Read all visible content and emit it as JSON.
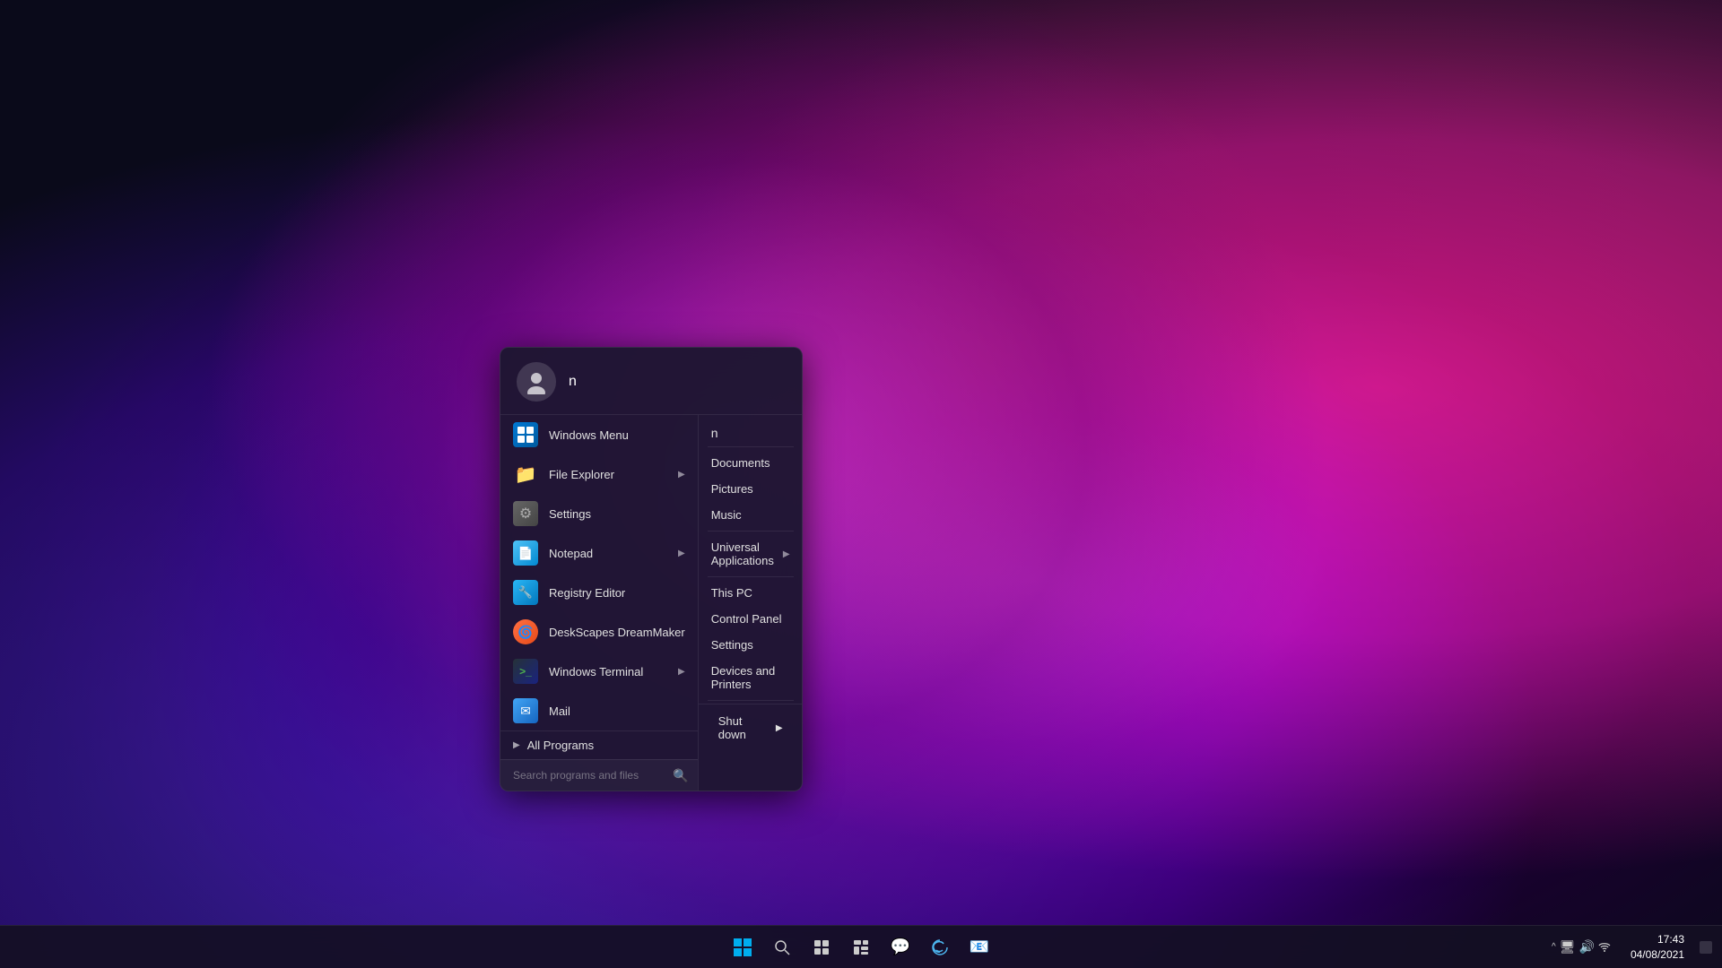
{
  "desktop": {
    "bg_color": "#0a0a1a"
  },
  "start_menu": {
    "user": {
      "name": "n",
      "avatar_icon": "👤"
    },
    "programs": [
      {
        "id": "windows-menu",
        "label": "Windows Menu",
        "icon": "win",
        "has_arrow": false
      },
      {
        "id": "file-explorer",
        "label": "File Explorer",
        "icon": "📁",
        "has_arrow": true
      },
      {
        "id": "settings",
        "label": "Settings",
        "icon": "⚙",
        "has_arrow": false
      },
      {
        "id": "notepad",
        "label": "Notepad",
        "icon": "📝",
        "has_arrow": true
      },
      {
        "id": "registry-editor",
        "label": "Registry Editor",
        "icon": "🔧",
        "has_arrow": false
      },
      {
        "id": "deskscapes",
        "label": "DeskScapes DreamMaker",
        "icon": "🌀",
        "has_arrow": false
      },
      {
        "id": "windows-terminal",
        "label": "Windows Terminal",
        "icon": "▶",
        "has_arrow": true
      },
      {
        "id": "mail",
        "label": "Mail",
        "icon": "✉",
        "has_arrow": false
      }
    ],
    "all_programs": "All Programs",
    "search_placeholder": "Search programs and files",
    "places": {
      "header": "n",
      "items": [
        {
          "id": "documents",
          "label": "Documents",
          "has_arrow": false
        },
        {
          "id": "pictures",
          "label": "Pictures",
          "has_arrow": false
        },
        {
          "id": "music",
          "label": "Music",
          "has_arrow": false
        },
        {
          "id": "universal-applications",
          "label": "Universal Applications",
          "has_arrow": true
        },
        {
          "id": "this-pc",
          "label": "This PC",
          "has_arrow": false
        },
        {
          "id": "control-panel",
          "label": "Control Panel",
          "has_arrow": false
        },
        {
          "id": "settings-place",
          "label": "Settings",
          "has_arrow": false
        },
        {
          "id": "devices-printers",
          "label": "Devices and Printers",
          "has_arrow": false
        }
      ]
    },
    "shutdown": {
      "label": "Shut down",
      "arrow": "▶"
    }
  },
  "taskbar": {
    "time": "17:43",
    "date": "04/08/2021",
    "icons": [
      {
        "id": "start",
        "icon": "⊞",
        "label": "Start"
      },
      {
        "id": "search",
        "icon": "🔍",
        "label": "Search"
      },
      {
        "id": "task-view",
        "icon": "⧉",
        "label": "Task View"
      },
      {
        "id": "widgets",
        "icon": "▦",
        "label": "Widgets"
      },
      {
        "id": "teams",
        "icon": "💬",
        "label": "Teams"
      },
      {
        "id": "edge",
        "icon": "🌐",
        "label": "Edge"
      },
      {
        "id": "mail-tb",
        "icon": "📧",
        "label": "Mail"
      }
    ],
    "system_tray": {
      "chevron": "^",
      "icons": [
        "🖥",
        "🔊",
        "📶"
      ]
    },
    "notification_icon": "💬"
  }
}
